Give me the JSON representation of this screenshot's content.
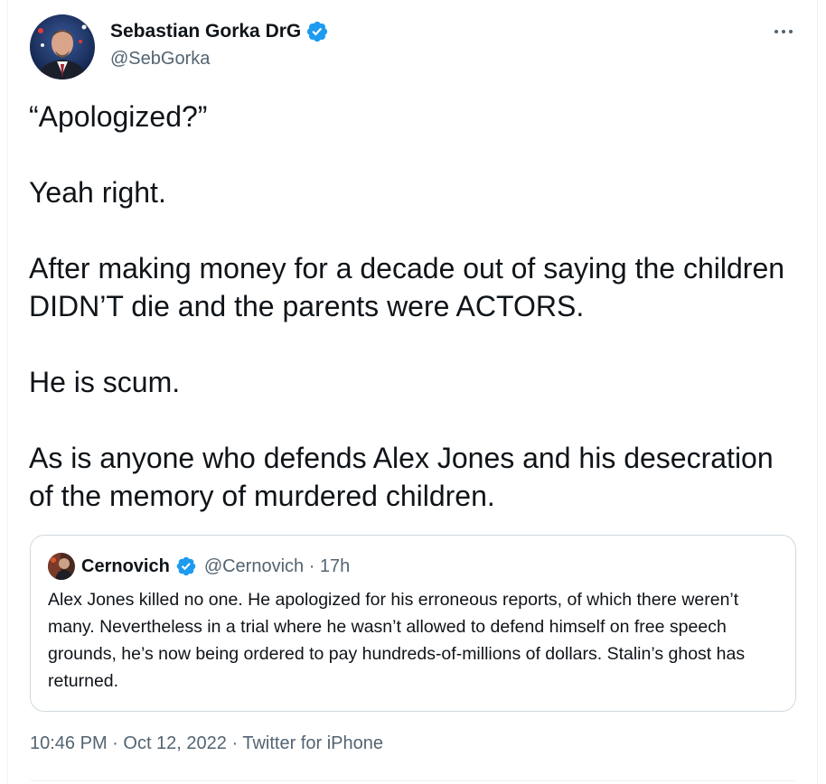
{
  "author": {
    "display_name": "Sebastian Gorka DrG",
    "handle": "@SebGorka",
    "avatar_icon": "profile-photo",
    "verified_icon": "verified-badge-icon"
  },
  "tweet": {
    "paragraphs": [
      "“Apologized?”",
      "Yeah right.",
      "After making money for a decade out of saying the children DIDN’T die and the parents were ACTORS.",
      "He is scum.",
      "As is anyone who defends Alex Jones and his desecration of the memory of murdered children."
    ]
  },
  "quote": {
    "display_name": "Cernovich",
    "handle_time": "@Cernovich · 17h",
    "text": "Alex Jones killed no one. He apologized for his erroneous reports, of which there weren’t many. Nevertheless in a trial where he wasn’t allowed to defend himself on free speech grounds, he’s now being ordered to pay hundreds-of-millions of dollars. Stalin’s ghost has returned."
  },
  "meta": {
    "time": "10:46 PM",
    "sep1": " · ",
    "date": "Oct 12, 2022",
    "sep2": " · ",
    "source": "Twitter for iPhone"
  },
  "colors": {
    "verified_blue": "#1d9bf0",
    "secondary_text": "#536471",
    "primary_text": "#0f1419",
    "border": "#cfd9de"
  }
}
